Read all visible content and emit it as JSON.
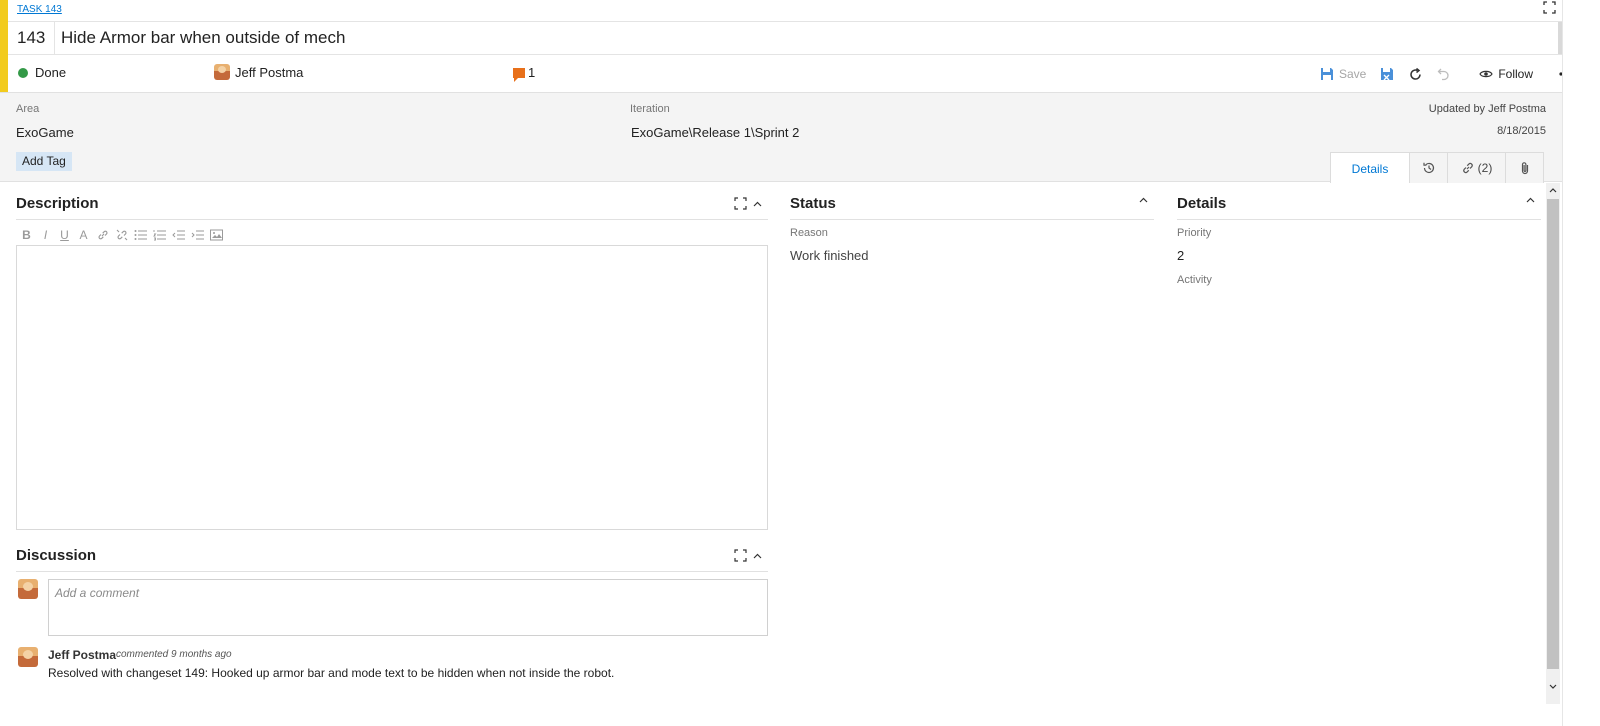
{
  "header": {
    "task_link": "TASK 143",
    "id": "143",
    "title": "Hide Armor bar when outside of mech",
    "state": "Done",
    "assignee": "Jeff Postma",
    "comment_count": "1",
    "toolbar": {
      "save_label": "Save",
      "follow_label": "Follow"
    }
  },
  "meta": {
    "area_label": "Area",
    "area_value": "ExoGame",
    "iteration_label": "Iteration",
    "iteration_value": "ExoGame\\Release 1\\Sprint 2",
    "add_tag_label": "Add Tag",
    "updated_by": "Updated by Jeff Postma",
    "updated_date": "8/18/2015"
  },
  "tabs": [
    {
      "label": "Details"
    },
    {
      "label": ""
    },
    {
      "label": "(2)"
    },
    {
      "label": ""
    }
  ],
  "description": {
    "title": "Description"
  },
  "discussion": {
    "title": "Discussion",
    "placeholder": "Add a comment",
    "comments": [
      {
        "author": "Jeff Postma",
        "meta": "commented 9 months ago",
        "text": "Resolved with changeset 149: Hooked up armor bar and mode text to be hidden when not inside the robot."
      }
    ]
  },
  "status": {
    "title": "Status",
    "reason_label": "Reason",
    "reason_value": "Work finished"
  },
  "details": {
    "title": "Details",
    "priority_label": "Priority",
    "priority_value": "2",
    "activity_label": "Activity"
  },
  "colors": {
    "accent": "#f2cb1d",
    "done_dot": "#339947",
    "link": "#0078d4",
    "comment_icon": "#e8701a"
  }
}
